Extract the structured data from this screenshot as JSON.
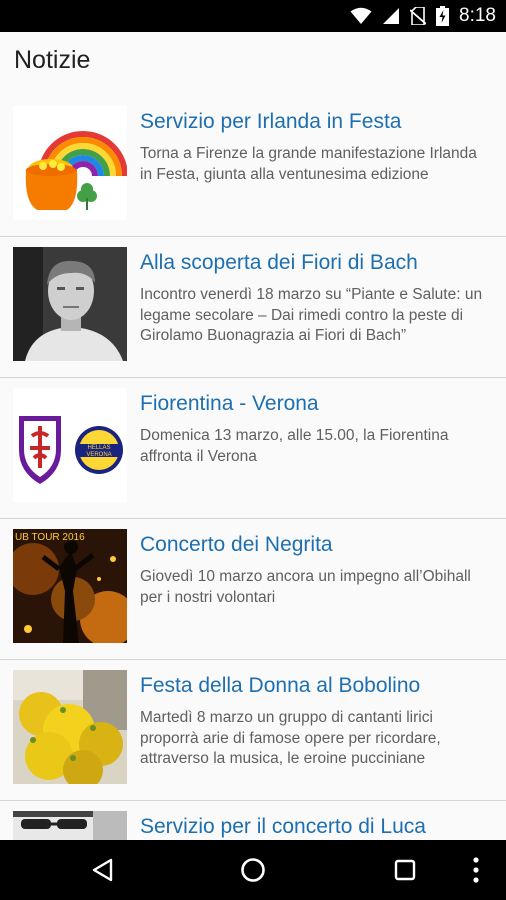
{
  "status_bar": {
    "time": "8:18",
    "icons": [
      "wifi-icon",
      "signal-icon",
      "no-sim-icon",
      "battery-charging-icon"
    ]
  },
  "header": {
    "title": "Notizie"
  },
  "news": [
    {
      "title": "Servizio per Irlanda in Festa",
      "description": "Torna a Firenze la grande manifestazione Irlanda in Festa, giunta alla ventunesima edizione",
      "image": "rainbow-pot-of-gold"
    },
    {
      "title": "Alla scoperta dei Fiori di Bach",
      "description": "Incontro venerdì 18 marzo su “Piante e Salute: un legame secolare – Dai rimedi contro la peste di Girolamo Buonagrazia ai Fiori di Bach”",
      "image": "portrait-photo"
    },
    {
      "title": "Fiorentina - Verona",
      "description": "Domenica 13 marzo, alle 15.00, la Fiorentina affronta il Verona",
      "image": "football-club-crests"
    },
    {
      "title": "Concerto dei Negrita",
      "description": "Giovedì 10 marzo ancora un impegno all’Obihall per i nostri volontari",
      "image": "concert-stage"
    },
    {
      "title": "Festa della Donna al Bobolino",
      "description": "Martedì 8 marzo un gruppo di cantanti lirici proporrà arie di famose opere per ricordare, attraverso la musica, le eroine pucciniane",
      "image": "mimosa-flowers"
    },
    {
      "title": "Servizio per il concerto di Luca",
      "description": "",
      "image": "person-sunglasses"
    }
  ],
  "thumb_text": {
    "hellas": "HELLAS",
    "verona": "VERONA",
    "tour": "UB TOUR 2016"
  },
  "nav_bar": {
    "buttons": [
      "back-icon",
      "home-icon",
      "recents-icon",
      "overflow-menu-icon"
    ]
  }
}
